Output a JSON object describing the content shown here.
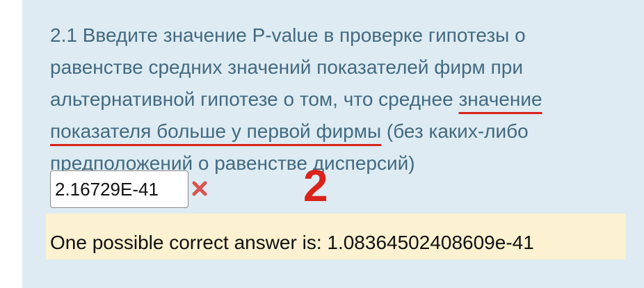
{
  "question": {
    "text_before": "2.1 Введите значение P-value в проверке гипотезы о равенстве средних значений показателей фирм при альтернативной гипотезе о том, что среднее ",
    "text_highlighted": "значение показателя больше у первой фирмы",
    "text_after": " (без каких-либо предположений о равенстве дисперсий)"
  },
  "answer_input": {
    "value": "2.16729E-41"
  },
  "status_icon": "incorrect-cross-icon",
  "annotation_number": "2",
  "feedback": {
    "text": "One possible correct answer is: 1.08364502408609e-41"
  },
  "colors": {
    "panel_background": "#deebf2",
    "question_text": "#436a80",
    "annotation_red": "#d9231b",
    "feedback_background": "#fcf1d0"
  }
}
